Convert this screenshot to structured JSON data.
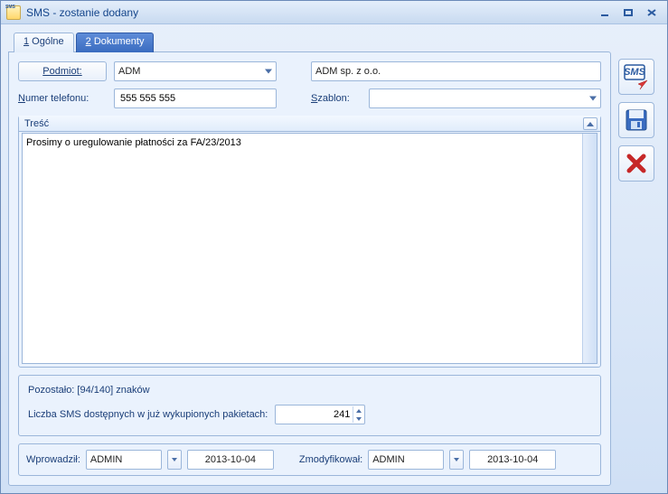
{
  "window": {
    "title": "SMS - zostanie dodany"
  },
  "tabs": {
    "general_prefix": "1",
    "general_label": " Ogólne",
    "documents_prefix": "2",
    "documents_label": " Dokumenty"
  },
  "fields": {
    "podmiot_label": "Podmiot:",
    "podmiot_code": "ADM",
    "podmiot_name": "ADM sp. z o.o.",
    "numer_label_prefix": "N",
    "numer_label_rest": "umer telefonu:",
    "numer_value": "555 555 555",
    "szablon_label_prefix": "S",
    "szablon_label_rest": "zablon:",
    "szablon_value": ""
  },
  "tresc": {
    "legend": "Treść",
    "text": "Prosimy o uregulowanie płatności za FA/23/2013"
  },
  "footer": {
    "pozostalo": "Pozostało: [94/140] znaków",
    "liczba_label": "Liczba SMS dostępnych w już wykupionych pakietach:",
    "liczba_value": "241"
  },
  "audit": {
    "wprowadzil_label": "Wprowadził:",
    "wprowadzil_user": "ADMIN",
    "wprowadzil_date": "2013-10-04",
    "zmodyfikowal_label": "Zmodyfikował:",
    "zmodyfikowal_user": "ADMIN",
    "zmodyfikowal_date": "2013-10-04"
  },
  "side": {
    "sms_btn": "SMS",
    "save_btn": "save",
    "delete_btn": "delete"
  }
}
